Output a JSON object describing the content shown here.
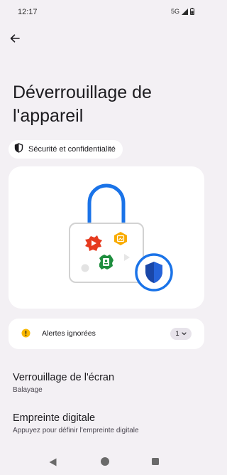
{
  "status_bar": {
    "time": "12:17",
    "network": "5G",
    "icons": [
      "signal-icon",
      "battery-icon"
    ]
  },
  "header": {
    "back_icon": "arrow-left-icon",
    "title": "Déverrouillage de l'appareil"
  },
  "breadcrumb": {
    "icon": "shield-icon",
    "label": "Sécurité et confidentialité"
  },
  "illustration": {
    "description_icons": [
      "padlock-icon",
      "video-app-icon",
      "gallery-app-icon",
      "contacts-app-icon",
      "security-shield-icon"
    ],
    "colors": {
      "shackle": "#1a73e8",
      "red": "#e63a1e",
      "yellow": "#f9ab00",
      "green": "#1e8e3e",
      "shield": "#1a47a8"
    }
  },
  "alerts": {
    "icon": "warning-icon",
    "label": "Alertes ignorées",
    "count": "1",
    "chevron_icon": "chevron-down-icon",
    "warning_color": "#f9b800"
  },
  "settings": [
    {
      "title": "Verrouillage de l'écran",
      "subtitle": "Balayage"
    },
    {
      "title": "Empreinte digitale",
      "subtitle": "Appuyez pour définir l'empreinte digitale"
    }
  ],
  "nav_bar": {
    "icons": [
      "nav-back-icon",
      "nav-home-icon",
      "nav-recents-icon"
    ]
  }
}
